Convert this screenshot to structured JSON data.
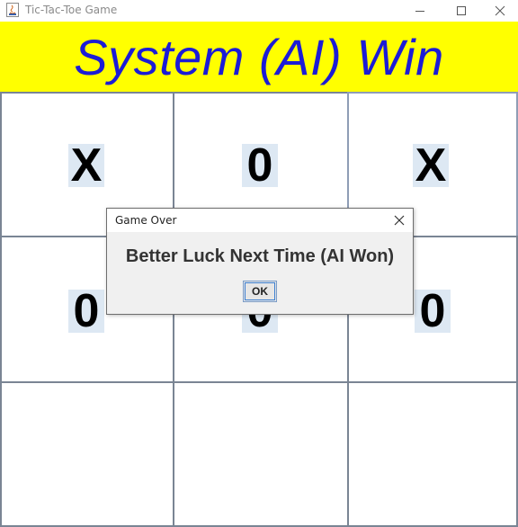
{
  "window": {
    "title": "Tic-Tac-Toe Game"
  },
  "banner": {
    "text": "System (AI) Win",
    "background": "#ffff00",
    "color": "#1c1cd6"
  },
  "board": {
    "cells": [
      "X",
      "0",
      "X",
      "0",
      "0",
      "0",
      "",
      "",
      ""
    ]
  },
  "dialog": {
    "title": "Game Over",
    "message": "Better Luck Next Time (AI Won)",
    "ok_label": "OK"
  }
}
